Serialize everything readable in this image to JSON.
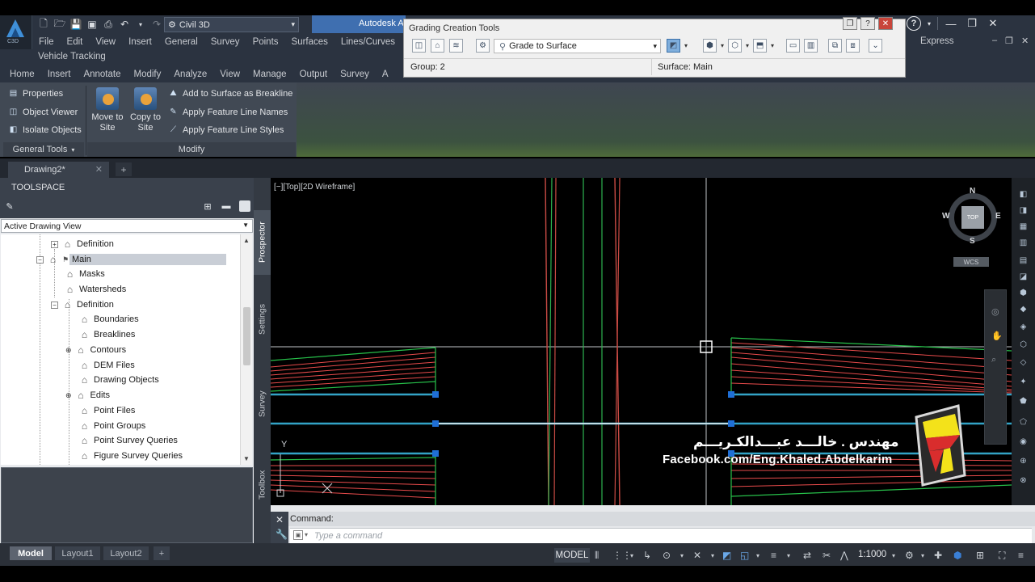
{
  "app": {
    "version_badge": "C3D",
    "workspace": "Civil 3D",
    "title_fragment": "Autodesk A"
  },
  "menu": {
    "items": [
      "File",
      "Edit",
      "View",
      "Insert",
      "General",
      "Survey",
      "Points",
      "Surfaces",
      "Lines/Curves"
    ],
    "express": "Express",
    "second_row": "Vehicle Tracking"
  },
  "ribbon_tabs": [
    "Home",
    "Insert",
    "Annotate",
    "Modify",
    "Analyze",
    "View",
    "Manage",
    "Output",
    "Survey",
    "A"
  ],
  "ribbon": {
    "general_tools": {
      "items": [
        "Properties",
        "Object Viewer",
        "Isolate Objects"
      ],
      "title": "General Tools"
    },
    "modify": {
      "move_to_site": [
        "Move to",
        "Site"
      ],
      "copy_to_site": [
        "Copy to",
        "Site"
      ],
      "items": [
        "Add to Surface as Breakline",
        "Apply Feature Line Names",
        "Apply Feature Line Styles"
      ],
      "title": "Modify"
    }
  },
  "grading_tools": {
    "title": "Grading Creation Tools",
    "criteria": "Grade to Surface",
    "group": "Group: 2",
    "surface": "Surface: Main"
  },
  "document_tab": "Drawing2*",
  "toolspace": {
    "title": "TOOLSPACE",
    "view": "Active Drawing View",
    "tabs": [
      "Prospector",
      "Settings",
      "Survey",
      "Toolbox"
    ],
    "tree": [
      {
        "label": "Definition",
        "icon": "definition-icon"
      },
      {
        "label": "Main",
        "icon": "surface-icon",
        "selected": true
      },
      {
        "label": "Masks",
        "icon": "masks-icon"
      },
      {
        "label": "Watersheds",
        "icon": "watersheds-icon"
      },
      {
        "label": "Definition",
        "icon": "definition-icon"
      },
      {
        "label": "Boundaries",
        "icon": "boundaries-icon"
      },
      {
        "label": "Breaklines",
        "icon": "breaklines-icon"
      },
      {
        "label": "Contours",
        "icon": "contours-icon"
      },
      {
        "label": "DEM Files",
        "icon": "dem-icon"
      },
      {
        "label": "Drawing Objects",
        "icon": "drawing-objects-icon"
      },
      {
        "label": "Edits",
        "icon": "edits-icon"
      },
      {
        "label": "Point Files",
        "icon": "point-files-icon"
      },
      {
        "label": "Point Groups",
        "icon": "point-groups-icon"
      },
      {
        "label": "Point Survey Queries",
        "icon": "query-icon"
      },
      {
        "label": "Figure Survey Queries",
        "icon": "query-icon"
      }
    ]
  },
  "viewport": {
    "label": "[−][Top][2D Wireframe]",
    "compass": {
      "n": "N",
      "s": "S",
      "e": "E",
      "w": "W",
      "face": "TOP"
    },
    "wcs": "WCS",
    "ucs_y": "Y"
  },
  "watermark": {
    "arabic": "مهندس . خالـــد عبـــدالكـريـــم",
    "facebook": "Facebook.com/Eng.Khaled.Abdelkarim"
  },
  "command": {
    "history": "Command:",
    "placeholder": "Type a command"
  },
  "layouts": [
    "Model",
    "Layout1",
    "Layout2"
  ],
  "status": {
    "model": "MODEL",
    "scale": "1:1000"
  },
  "colors": {
    "green_line": "#27c04a",
    "red_line": "#e84b4b",
    "cyan_line": "#33a3c6",
    "grip_blue": "#1f6fd6"
  }
}
